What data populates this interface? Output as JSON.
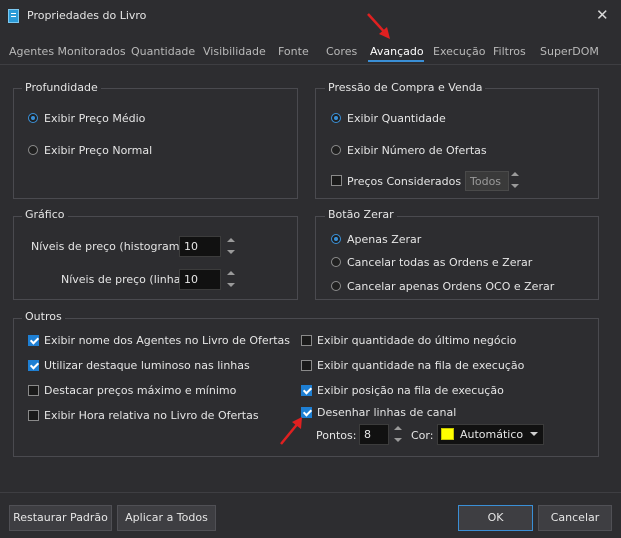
{
  "window": {
    "title": "Propriedades do Livro"
  },
  "tabs": [
    {
      "label": "Agentes Monitorados",
      "active": false
    },
    {
      "label": "Quantidade",
      "active": false
    },
    {
      "label": "Visibilidade",
      "active": false
    },
    {
      "label": "Fonte",
      "active": false
    },
    {
      "label": "Cores",
      "active": false
    },
    {
      "label": "Avançado",
      "active": true
    },
    {
      "label": "Execução",
      "active": false
    },
    {
      "label": "Filtros",
      "active": false
    },
    {
      "label": "SuperDOM",
      "active": false
    }
  ],
  "profundidade": {
    "title": "Profundidade",
    "options": [
      {
        "label": "Exibir Preço Médio",
        "selected": true
      },
      {
        "label": "Exibir Preço Normal",
        "selected": false
      }
    ]
  },
  "pressao": {
    "title": "Pressão de Compra e Venda",
    "options": [
      {
        "label": "Exibir Quantidade",
        "selected": true
      },
      {
        "label": "Exibir Número de Ofertas",
        "selected": false
      }
    ],
    "precos_considerados": {
      "label": "Preços Considerados",
      "checked": false,
      "value": "Todos"
    }
  },
  "grafico": {
    "title": "Gráfico",
    "histograma": {
      "label": "Níveis de preço (histograma):",
      "value": "10"
    },
    "linha": {
      "label": "Níveis de preço (linha):",
      "value": "10"
    }
  },
  "botao_zerar": {
    "title": "Botão Zerar",
    "options": [
      {
        "label": "Apenas Zerar",
        "selected": true
      },
      {
        "label": "Cancelar todas as Ordens e Zerar",
        "selected": false
      },
      {
        "label": "Cancelar apenas Ordens OCO e Zerar",
        "selected": false
      }
    ]
  },
  "outros": {
    "title": "Outros",
    "left": [
      {
        "label": "Exibir nome dos Agentes no Livro de Ofertas",
        "checked": true
      },
      {
        "label": "Utilizar destaque luminoso nas linhas",
        "checked": true
      },
      {
        "label": "Destacar preços máximo e mínimo",
        "checked": false
      },
      {
        "label": "Exibir Hora relativa no Livro de Ofertas",
        "checked": false
      }
    ],
    "right": [
      {
        "label": "Exibir quantidade do último negócio",
        "checked": false
      },
      {
        "label": "Exibir quantidade na fila de execução",
        "checked": false
      },
      {
        "label": "Exibir posição na fila de execução",
        "checked": true
      },
      {
        "label": "Desenhar linhas de canal",
        "checked": true
      }
    ],
    "pontos": {
      "label": "Pontos:",
      "value": "8"
    },
    "cor": {
      "label": "Cor:",
      "value": "Automático",
      "swatch_color": "#ffff00"
    }
  },
  "footer": {
    "restore": "Restaurar Padrão",
    "apply_all": "Aplicar a Todos",
    "ok": "OK",
    "cancel": "Cancelar"
  },
  "colors": {
    "background": "#2d2d30",
    "accent": "#3a8fd6",
    "checkbox_on": "#1e7fd3",
    "annotation_arrow": "#e02020"
  }
}
